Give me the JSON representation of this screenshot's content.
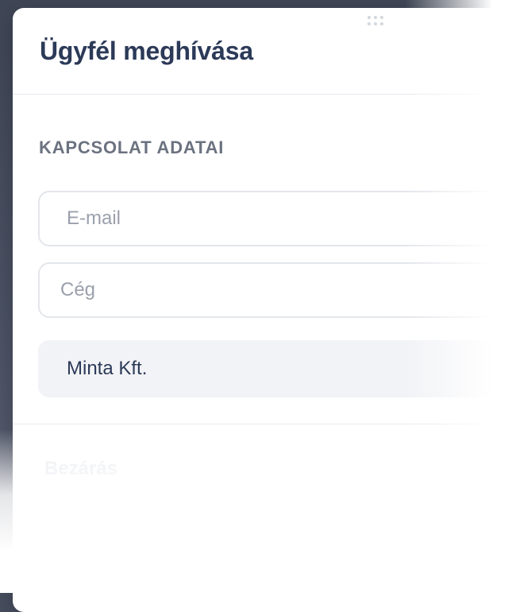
{
  "dialog": {
    "title": "Ügyfél meghívása",
    "section_label": "KAPCSOLAT ADATAI",
    "email_placeholder": "E-mail",
    "company_placeholder": "Cég",
    "company_option": "Minta Kft.",
    "close_label": "Bezárás"
  },
  "colors": {
    "title": "#2c3a58",
    "section_label": "#6b7280",
    "field_border": "#e3e6eb",
    "option_bg": "#f2f3f6",
    "backdrop": "#474e5f"
  },
  "icons": {
    "drag_handle": "grip-dots-icon"
  }
}
